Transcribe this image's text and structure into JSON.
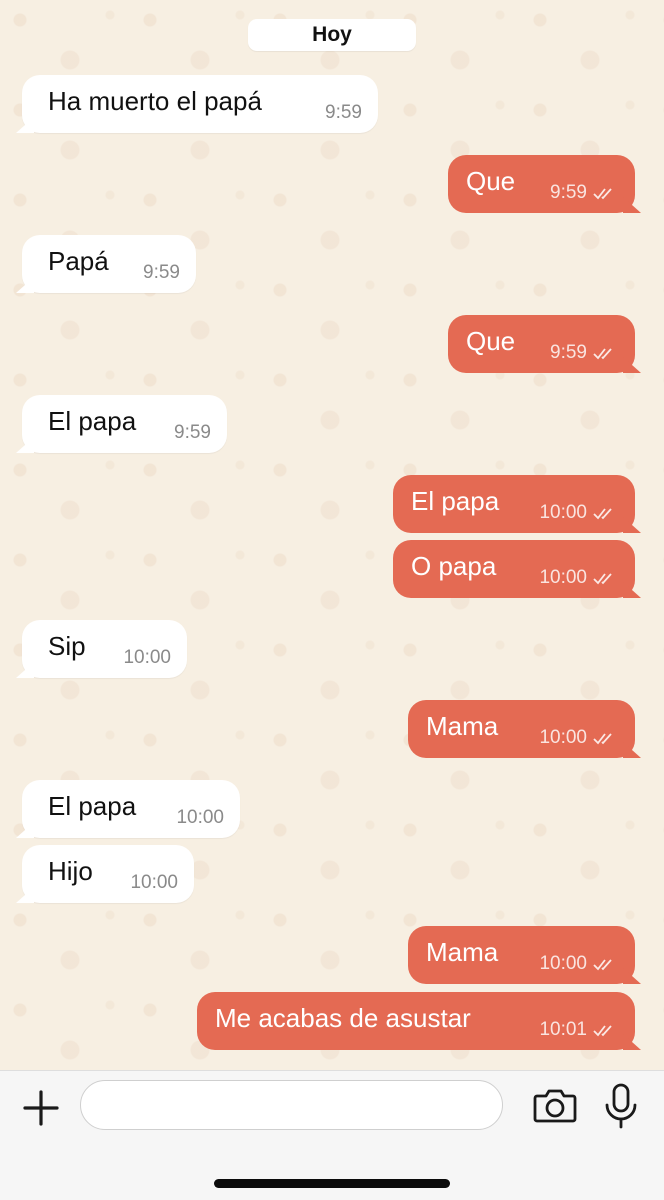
{
  "chat": {
    "date_label": "Hoy",
    "messages": [
      {
        "direction": "in",
        "text": "Ha muerto el papá",
        "time": "9:59"
      },
      {
        "direction": "out",
        "text": "Que",
        "time": "9:59",
        "status": "read"
      },
      {
        "direction": "in",
        "text": "Papá",
        "time": "9:59"
      },
      {
        "direction": "out",
        "text": "Que",
        "time": "9:59",
        "status": "read"
      },
      {
        "direction": "in",
        "text": "El papa",
        "time": "9:59"
      },
      {
        "direction": "out",
        "text": "El papa",
        "time": "10:00",
        "status": "read"
      },
      {
        "direction": "out",
        "text": "O papa",
        "time": "10:00",
        "status": "read"
      },
      {
        "direction": "in",
        "text": "Sip",
        "time": "10:00"
      },
      {
        "direction": "out",
        "text": "Mama",
        "time": "10:00",
        "status": "read"
      },
      {
        "direction": "in",
        "text": "El papa",
        "time": "10:00"
      },
      {
        "direction": "in",
        "text": "Hijo",
        "time": "10:00"
      },
      {
        "direction": "out",
        "text": "Mama",
        "time": "10:00",
        "status": "read"
      },
      {
        "direction": "out",
        "text": "Me acabas de asustar",
        "time": "10:01",
        "status": "read"
      }
    ]
  },
  "composer": {
    "message_value": "",
    "icons": [
      "plus-icon",
      "sticker-icon",
      "camera-icon",
      "microphone-icon"
    ]
  },
  "colors": {
    "outgoing_bubble": "#e46a53",
    "incoming_bubble": "#ffffff",
    "chat_background": "#f7efe2"
  }
}
